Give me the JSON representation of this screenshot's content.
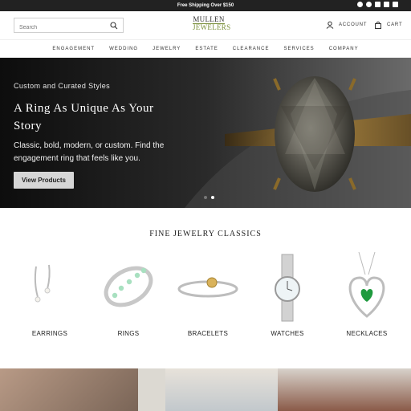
{
  "announcement": "Free Shipping Over $150",
  "social_icons": [
    "facebook-icon",
    "pinterest-icon",
    "instagram-icon",
    "tiktok-icon",
    "youtube-icon"
  ],
  "search": {
    "placeholder": "Search"
  },
  "logo": {
    "line1": "MULLEN",
    "line2": "JEWELERS"
  },
  "header": {
    "account_label": "ACCOUNT",
    "cart_label": "CART"
  },
  "nav": [
    "ENGAGEMENT",
    "WEDDING",
    "JEWELRY",
    "ESTATE",
    "CLEARANCE",
    "SERVICES",
    "COMPANY"
  ],
  "hero": {
    "eyebrow": "Custom and Curated Styles",
    "title": "A Ring As Unique As Your Story",
    "subtitle": "Classic, bold, modern, or custom. Find the engagement ring that feels like you.",
    "button": "View Products",
    "slide_count": 2,
    "active_slide": 2
  },
  "classics": {
    "title": "FINE JEWELRY CLASSICS",
    "items": [
      "EARRINGS",
      "RINGS",
      "BRACELETS",
      "WATCHES",
      "NECKLACES"
    ]
  },
  "colors": {
    "topbar": "#222222",
    "logo_accent": "#7a8f3a",
    "hero_button": "#d6d6d6"
  }
}
